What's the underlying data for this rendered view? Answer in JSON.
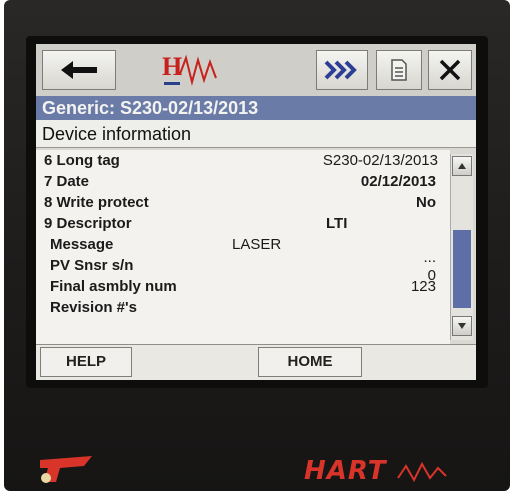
{
  "toolbar": {
    "back_icon": "arrow-left-icon",
    "logo_letter": "H",
    "forward_icon": "double-chevron-right-icon",
    "document_icon": "document-icon",
    "close_icon": "close-icon"
  },
  "title": "Generic: S230-02/13/2013",
  "subtitle": "Device information",
  "rows": [
    {
      "label": "6 Long tag",
      "value": "S230-02/13/2013"
    },
    {
      "label": "7 Date",
      "value": "02/12/2013"
    },
    {
      "label": "8 Write protect",
      "value": "No"
    },
    {
      "label": "9 Descriptor",
      "value": "LTI"
    },
    {
      "label": "Message",
      "value": "LASER"
    },
    {
      "label": "PV Snsr s/n",
      "value": "0",
      "extra": "..."
    },
    {
      "label": "Final asmbly num",
      "value": "123"
    },
    {
      "label": "Revision #'s",
      "value": ""
    }
  ],
  "buttons": {
    "help": "HELP",
    "home": "HOME"
  },
  "brand": {
    "hart": "HART",
    "accent_red": "#d8342a",
    "title_bar_color": "#6b7ba8"
  }
}
